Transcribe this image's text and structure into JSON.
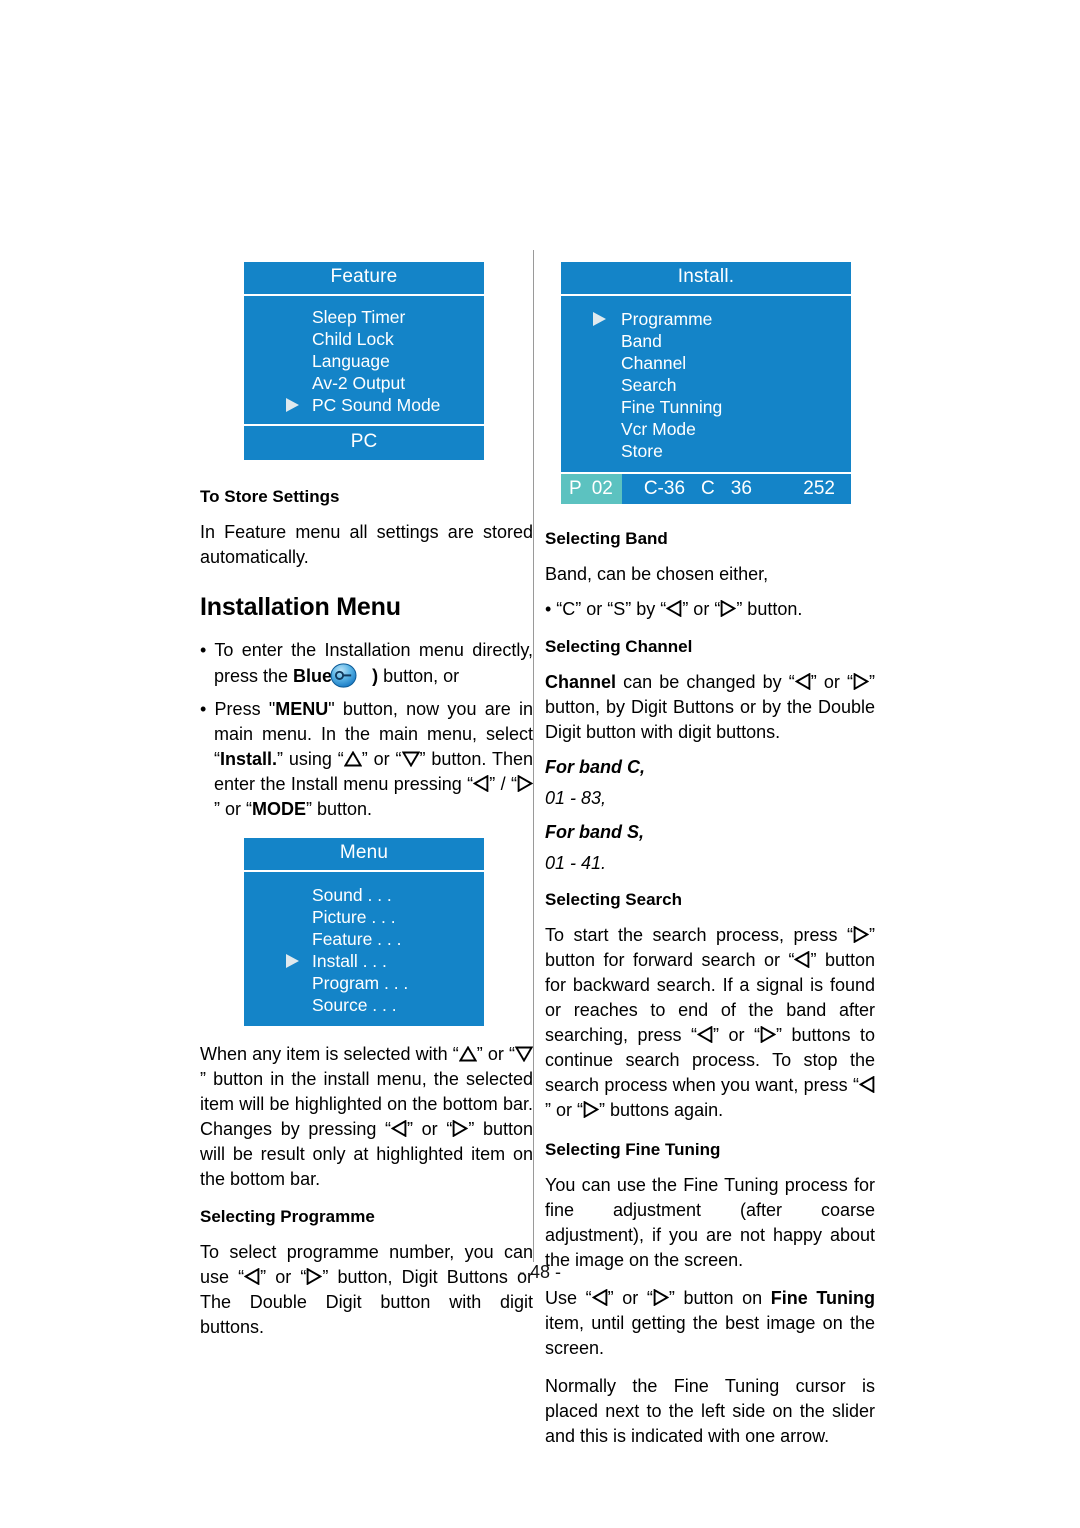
{
  "page": {
    "number_label": "- 48 -"
  },
  "osd_feature": {
    "title": "Feature",
    "items": [
      {
        "label": "Sleep Timer",
        "selected": false
      },
      {
        "label": "Child Lock",
        "selected": false
      },
      {
        "label": "Language",
        "selected": false
      },
      {
        "label": "Av-2 Output",
        "selected": false
      },
      {
        "label": "PC Sound Mode",
        "selected": true
      }
    ],
    "footer": "PC"
  },
  "osd_install": {
    "title": "Install.",
    "items": [
      {
        "label": "Programme",
        "selected": true
      },
      {
        "label": "Band",
        "selected": false
      },
      {
        "label": "Channel",
        "selected": false
      },
      {
        "label": "Search",
        "selected": false
      },
      {
        "label": "Fine Tunning",
        "selected": false
      },
      {
        "label": "Vcr Mode",
        "selected": false
      },
      {
        "label": "Store",
        "selected": false
      }
    ],
    "statusbar": {
      "highlight_label": "P",
      "highlight_value": "02",
      "field_1": "C-36",
      "field_2": "C",
      "field_3": "36",
      "field_right": "252",
      "highlight_color": "#5cc2c0"
    }
  },
  "osd_menu": {
    "title": "Menu",
    "items": [
      {
        "label": "Sound . . .",
        "selected": false
      },
      {
        "label": "Picture . . .",
        "selected": false
      },
      {
        "label": "Feature . . .",
        "selected": false
      },
      {
        "label": "Install . . .",
        "selected": true
      },
      {
        "label": "Program . . .",
        "selected": false
      },
      {
        "label": "Source . . .",
        "selected": false
      }
    ]
  },
  "left_column": {
    "heading_store": "To Store Settings",
    "para_store": "In Feature menu all settings are stored automatically.",
    "heading_installation": "Installation Menu",
    "bullet1_part1": "• To enter the Installation menu directly, press the ",
    "bullet1_blue": "Blue",
    "bullet1_paren_open": " (",
    "bullet1_paren_close": ")",
    "bullet1_part2": " button, or",
    "bullet2_lead": "• Press \"",
    "bullet2_menu": "MENU",
    "bullet2_mid1": "\" button, now you are in main menu. In the main menu, select “",
    "bullet2_install": "Install.",
    "bullet2_mid2": "” using “",
    "bullet2_mid3": "” or “",
    "bullet2_mid4": "” button. Then enter the Install menu pressing “",
    "bullet2_mid5": "” / “",
    "bullet2_mid6": "” or “",
    "bullet2_mode": "MODE",
    "bullet2_end": "” button.",
    "para_highlight_1": "When any item is selected with “",
    "para_highlight_2": "” or “",
    "para_highlight_3": "” button in the install menu, the selected item will be highlighted on the bottom bar. Changes by pressing “",
    "para_highlight_4": "” or “",
    "para_highlight_5": "” button will be result only at highlighted item on the bottom bar.",
    "heading_programme": "Selecting Programme",
    "para_programme_1": "To select programme number, you can use “",
    "para_programme_2": "” or “",
    "para_programme_3": "” button, Digit Buttons or The Double Digit button with digit buttons."
  },
  "right_column": {
    "heading_band": "Selecting Band",
    "para_band": "Band, can be chosen either,",
    "bullet_band_1": "• “C” or “S” by “",
    "bullet_band_2": "” or “",
    "bullet_band_3": "” button.",
    "heading_channel": "Selecting Channel",
    "para_channel_bold": "Channel",
    "para_channel_1": " can be changed by “",
    "para_channel_2": "” or “",
    "para_channel_3": "” button, by Digit Buttons or by the Double Digit button with digit buttons.",
    "for_band_c": "For band C,",
    "range_c": "01 - 83,",
    "for_band_s": "For band S,",
    "range_s": "01 - 41.",
    "heading_search": "Selecting Search",
    "para_search_1": "To start the search process, press “",
    "para_search_2": "” button for forward search or “",
    "para_search_3": "” button for backward search. If a signal is found or reaches to end of the band after searching, press “",
    "para_search_4": "” or “",
    "para_search_5": "” buttons to continue search process. To stop the search process  when you want, press “",
    "para_search_6": "” or “",
    "para_search_7": "” buttons again.",
    "heading_finetuning": "Selecting Fine Tuning",
    "para_finetuning_1": "You can use the Fine Tuning process for fine adjustment (after coarse adjustment), if you are not happy about the image on the screen.",
    "para_finetuning_2a": "Use “",
    "para_finetuning_2b": "” or “",
    "para_finetuning_2c": "” button on ",
    "para_finetuning_2bold": "Fine Tuning",
    "para_finetuning_2d": " item, until getting the best image on the screen.",
    "para_finetuning_3": "Normally the Fine Tuning cursor is placed next to the left side on the slider and this is indicated with one arrow."
  },
  "colors": {
    "osd_blue": "#1484c8",
    "osd_highlight_teal": "#5cc2c0",
    "cursor_arrow": "#dfe9ee"
  }
}
